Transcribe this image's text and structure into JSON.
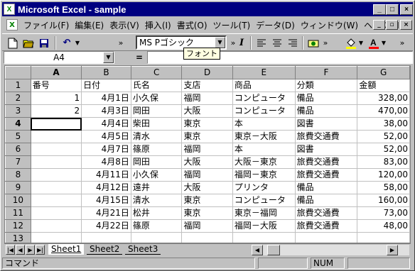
{
  "window": {
    "title": "Microsoft Excel - sample"
  },
  "menu": [
    "ファイル(F)",
    "編集(E)",
    "表示(V)",
    "挿入(I)",
    "書式(O)",
    "ツール(T)",
    "データ(D)",
    "ウィンドウ(W)",
    "ヘルプ(H)"
  ],
  "toolbar": {
    "font_name": "MS Pゴシック",
    "tooltip": "フォント"
  },
  "formula": {
    "name_box": "A4",
    "eq": "=",
    "content": ""
  },
  "columns": [
    "A",
    "B",
    "C",
    "D",
    "E",
    "F",
    "G"
  ],
  "rows": [
    {
      "n": "1",
      "A": "番号",
      "B": "日付",
      "C": "氏名",
      "D": "支店",
      "E": "商品",
      "F": "分類",
      "G": "金額"
    },
    {
      "n": "2",
      "A": "1",
      "B": "4月1日",
      "C": "小久保",
      "D": "福岡",
      "E": "コンピュータ",
      "F": "備品",
      "G": "328,00"
    },
    {
      "n": "3",
      "A": "2",
      "B": "4月3日",
      "C": "岡田",
      "D": "大阪",
      "E": "コンピュータ",
      "F": "備品",
      "G": "470,00"
    },
    {
      "n": "4",
      "A": "",
      "B": "4月4日",
      "C": "柴田",
      "D": "東京",
      "E": "本",
      "F": "図書",
      "G": "38,00"
    },
    {
      "n": "5",
      "A": "",
      "B": "4月5日",
      "C": "清水",
      "D": "東京",
      "E": "東京－大阪",
      "F": "旅費交通費",
      "G": "52,00"
    },
    {
      "n": "6",
      "A": "",
      "B": "4月7日",
      "C": "篠原",
      "D": "福岡",
      "E": "本",
      "F": "図書",
      "G": "52,00"
    },
    {
      "n": "7",
      "A": "",
      "B": "4月8日",
      "C": "岡田",
      "D": "大阪",
      "E": "大阪－東京",
      "F": "旅費交通費",
      "G": "83,00"
    },
    {
      "n": "8",
      "A": "",
      "B": "4月11日",
      "C": "小久保",
      "D": "福岡",
      "E": "福岡－東京",
      "F": "旅費交通費",
      "G": "120,00"
    },
    {
      "n": "9",
      "A": "",
      "B": "4月12日",
      "C": "遠井",
      "D": "大阪",
      "E": "プリンタ",
      "F": "備品",
      "G": "58,00"
    },
    {
      "n": "10",
      "A": "",
      "B": "4月15日",
      "C": "清水",
      "D": "東京",
      "E": "コンピュータ",
      "F": "備品",
      "G": "160,00"
    },
    {
      "n": "11",
      "A": "",
      "B": "4月21日",
      "C": "松井",
      "D": "東京",
      "E": "東京－福岡",
      "F": "旅費交通費",
      "G": "73,00"
    },
    {
      "n": "12",
      "A": "",
      "B": "4月22日",
      "C": "篠原",
      "D": "福岡",
      "E": "福岡－大阪",
      "F": "旅費交通費",
      "G": "48,00"
    },
    {
      "n": "13",
      "A": "",
      "B": "",
      "C": "",
      "D": "",
      "E": "",
      "F": "",
      "G": ""
    }
  ],
  "sheets": [
    "Sheet1",
    "Sheet2",
    "Sheet3"
  ],
  "status": {
    "mode": "コマンド",
    "num": "NUM"
  }
}
